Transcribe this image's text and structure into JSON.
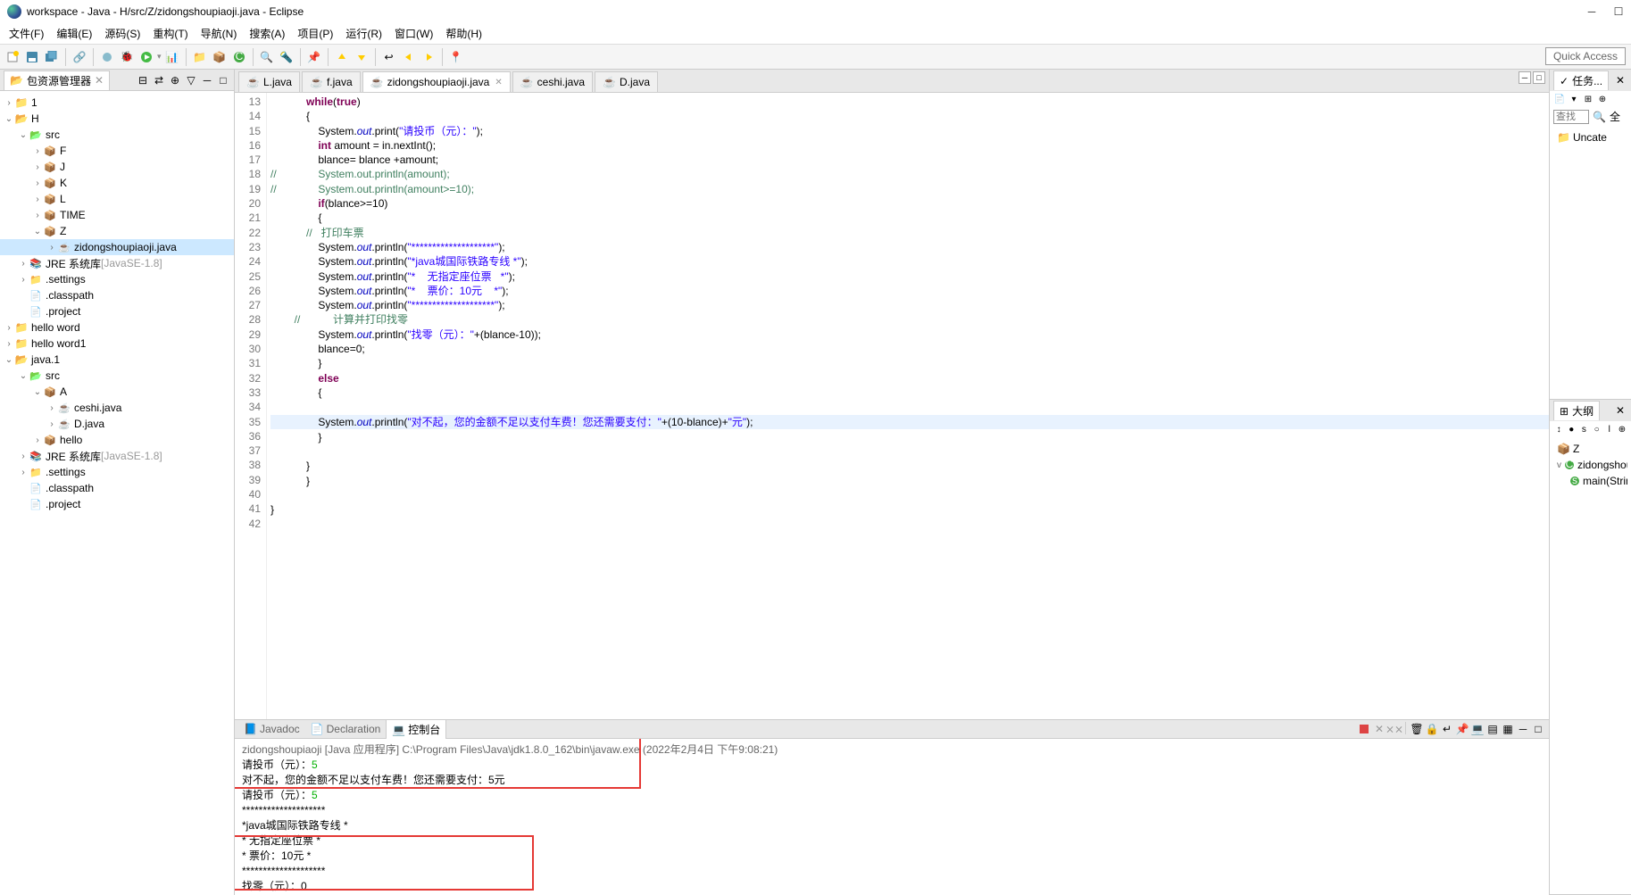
{
  "window": {
    "title": "workspace - Java - H/src/Z/zidongshoupiaoji.java - Eclipse"
  },
  "menus": [
    "文件(F)",
    "编辑(E)",
    "源码(S)",
    "重构(T)",
    "导航(N)",
    "搜索(A)",
    "项目(P)",
    "运行(R)",
    "窗口(W)",
    "帮助(H)"
  ],
  "quick_access": "Quick Access",
  "package_explorer": {
    "title": "包资源管理器",
    "tree": [
      {
        "d": 0,
        "tw": ">",
        "ic": "proj-closed",
        "label": "1"
      },
      {
        "d": 0,
        "tw": "v",
        "ic": "proj-open",
        "label": "H"
      },
      {
        "d": 1,
        "tw": "v",
        "ic": "srcf",
        "label": "src"
      },
      {
        "d": 2,
        "tw": ">",
        "ic": "pkg",
        "label": "F"
      },
      {
        "d": 2,
        "tw": ">",
        "ic": "pkg",
        "label": "J"
      },
      {
        "d": 2,
        "tw": ">",
        "ic": "pkg",
        "label": "K"
      },
      {
        "d": 2,
        "tw": ">",
        "ic": "pkg",
        "label": "L"
      },
      {
        "d": 2,
        "tw": ">",
        "ic": "pkg",
        "label": "TIME"
      },
      {
        "d": 2,
        "tw": "v",
        "ic": "pkg",
        "label": "Z"
      },
      {
        "d": 3,
        "tw": ">",
        "ic": "jfile",
        "label": "zidongshoupiaoji.java",
        "sel": true
      },
      {
        "d": 1,
        "tw": ">",
        "ic": "jar",
        "label": "JRE 系统库 ",
        "extra": "[JavaSE-1.8]"
      },
      {
        "d": 1,
        "tw": ">",
        "ic": "gfolder",
        "label": ".settings"
      },
      {
        "d": 1,
        "tw": "",
        "ic": "gfile",
        "label": ".classpath"
      },
      {
        "d": 1,
        "tw": "",
        "ic": "gfile",
        "label": ".project"
      },
      {
        "d": 0,
        "tw": ">",
        "ic": "proj-closed",
        "label": "hello word"
      },
      {
        "d": 0,
        "tw": ">",
        "ic": "proj-closed",
        "label": "hello word1"
      },
      {
        "d": 0,
        "tw": "v",
        "ic": "proj-open",
        "label": "java.1"
      },
      {
        "d": 1,
        "tw": "v",
        "ic": "srcf",
        "label": "src"
      },
      {
        "d": 2,
        "tw": "v",
        "ic": "pkg",
        "label": "A"
      },
      {
        "d": 3,
        "tw": ">",
        "ic": "jfile",
        "label": "ceshi.java"
      },
      {
        "d": 3,
        "tw": ">",
        "ic": "jfile",
        "label": "D.java"
      },
      {
        "d": 2,
        "tw": ">",
        "ic": "pkg",
        "label": "hello"
      },
      {
        "d": 1,
        "tw": ">",
        "ic": "jar",
        "label": "JRE 系统库 ",
        "extra": "[JavaSE-1.8]"
      },
      {
        "d": 1,
        "tw": ">",
        "ic": "gfolder",
        "label": ".settings"
      },
      {
        "d": 1,
        "tw": "",
        "ic": "gfile",
        "label": ".classpath"
      },
      {
        "d": 1,
        "tw": "",
        "ic": "gfile",
        "label": ".project"
      }
    ]
  },
  "editor_tabs": [
    {
      "label": "L.java",
      "active": false
    },
    {
      "label": "f.java",
      "active": false
    },
    {
      "label": "zidongshoupiaoji.java",
      "active": true
    },
    {
      "label": "ceshi.java",
      "active": false
    },
    {
      "label": "D.java",
      "active": false
    }
  ],
  "code": {
    "first_line": 13,
    "highlight_line": 35,
    "lines": [
      [
        {
          "t": "            "
        },
        {
          "t": "while",
          "c": "kw"
        },
        {
          "t": "("
        },
        {
          "t": "true",
          "c": "kw"
        },
        {
          "t": ")"
        }
      ],
      [
        {
          "t": "            {"
        }
      ],
      [
        {
          "t": "                System."
        },
        {
          "t": "out",
          "c": "fld"
        },
        {
          "t": ".print("
        },
        {
          "t": "\"请投币（元）：\"",
          "c": "str"
        },
        {
          "t": ");"
        }
      ],
      [
        {
          "t": "                "
        },
        {
          "t": "int",
          "c": "kw"
        },
        {
          "t": " amount = in.nextInt();"
        }
      ],
      [
        {
          "t": "                blance= blance +amount;"
        }
      ],
      [
        {
          "t": "//              System.out.println(amount);",
          "c": "cmt"
        }
      ],
      [
        {
          "t": "//              System.out.println(amount>=10);",
          "c": "cmt"
        }
      ],
      [
        {
          "t": "                "
        },
        {
          "t": "if",
          "c": "kw"
        },
        {
          "t": "(blance>=10)"
        }
      ],
      [
        {
          "t": "                {"
        }
      ],
      [
        {
          "t": "            //   打印车票",
          "c": "cmt"
        }
      ],
      [
        {
          "t": "                System."
        },
        {
          "t": "out",
          "c": "fld"
        },
        {
          "t": ".println("
        },
        {
          "t": "\"********************\"",
          "c": "str"
        },
        {
          "t": ");"
        }
      ],
      [
        {
          "t": "                System."
        },
        {
          "t": "out",
          "c": "fld"
        },
        {
          "t": ".println("
        },
        {
          "t": "\"*java城国际铁路专线 *\"",
          "c": "str"
        },
        {
          "t": ");"
        }
      ],
      [
        {
          "t": "                System."
        },
        {
          "t": "out",
          "c": "fld"
        },
        {
          "t": ".println("
        },
        {
          "t": "\"*    无指定座位票   *\"",
          "c": "str"
        },
        {
          "t": ");"
        }
      ],
      [
        {
          "t": "                System."
        },
        {
          "t": "out",
          "c": "fld"
        },
        {
          "t": ".println("
        },
        {
          "t": "\"*    票价：10元    *\"",
          "c": "str"
        },
        {
          "t": ");"
        }
      ],
      [
        {
          "t": "                System."
        },
        {
          "t": "out",
          "c": "fld"
        },
        {
          "t": ".println("
        },
        {
          "t": "\"********************\"",
          "c": "str"
        },
        {
          "t": ");"
        }
      ],
      [
        {
          "t": "        //           计算并打印找零",
          "c": "cmt"
        }
      ],
      [
        {
          "t": "                System."
        },
        {
          "t": "out",
          "c": "fld"
        },
        {
          "t": ".println("
        },
        {
          "t": "\"找零（元）：\"",
          "c": "str"
        },
        {
          "t": "+(blance-10));"
        }
      ],
      [
        {
          "t": "                blance=0;"
        }
      ],
      [
        {
          "t": "                }"
        }
      ],
      [
        {
          "t": "                "
        },
        {
          "t": "else",
          "c": "kw"
        }
      ],
      [
        {
          "t": "                {"
        }
      ],
      [
        {
          "t": ""
        }
      ],
      [
        {
          "t": "                System."
        },
        {
          "t": "out",
          "c": "fld"
        },
        {
          "t": ".println("
        },
        {
          "t": "\"对不起，您的金额不足以支付车费！您还需要支付：\"",
          "c": "str"
        },
        {
          "t": "+(10-blance)+"
        },
        {
          "t": "\"元\"",
          "c": "str"
        },
        {
          "t": ");"
        }
      ],
      [
        {
          "t": "                }"
        }
      ],
      [
        {
          "t": ""
        }
      ],
      [
        {
          "t": "            }"
        }
      ],
      [
        {
          "t": "            }"
        }
      ],
      [
        {
          "t": ""
        }
      ],
      [
        {
          "t": "}"
        }
      ],
      [
        {
          "t": ""
        }
      ]
    ]
  },
  "bottom_tabs": {
    "javadoc": "Javadoc",
    "declaration": "Declaration",
    "console": "控制台"
  },
  "console": {
    "header": "zidongshoupiaoji [Java 应用程序] C:\\Program Files\\Java\\jdk1.8.0_162\\bin\\javaw.exe  (2022年2月4日 下午9:08:21)",
    "lines": [
      {
        "pre": "请投币（元）：",
        "in": "5"
      },
      {
        "pre": "对不起，您的金额不足以支付车费！您还需要支付：5元"
      },
      {
        "pre": "请投币（元）：",
        "in": "5"
      },
      {
        "pre": "********************"
      },
      {
        "pre": "*java城国际铁路专线 *"
      },
      {
        "pre": "*    无指定座位票   *"
      },
      {
        "pre": "*    票价：10元    *"
      },
      {
        "pre": "********************"
      },
      {
        "pre": "找零（元）：0"
      }
    ]
  },
  "tasks": {
    "title": "任务...",
    "search": "查找",
    "all": "全",
    "uncat": "Uncate"
  },
  "outline": {
    "title": "大纲",
    "items": [
      {
        "label": "Z"
      },
      {
        "label": "zidongshoupia"
      },
      {
        "label": "main(String",
        "sub": true
      }
    ]
  }
}
